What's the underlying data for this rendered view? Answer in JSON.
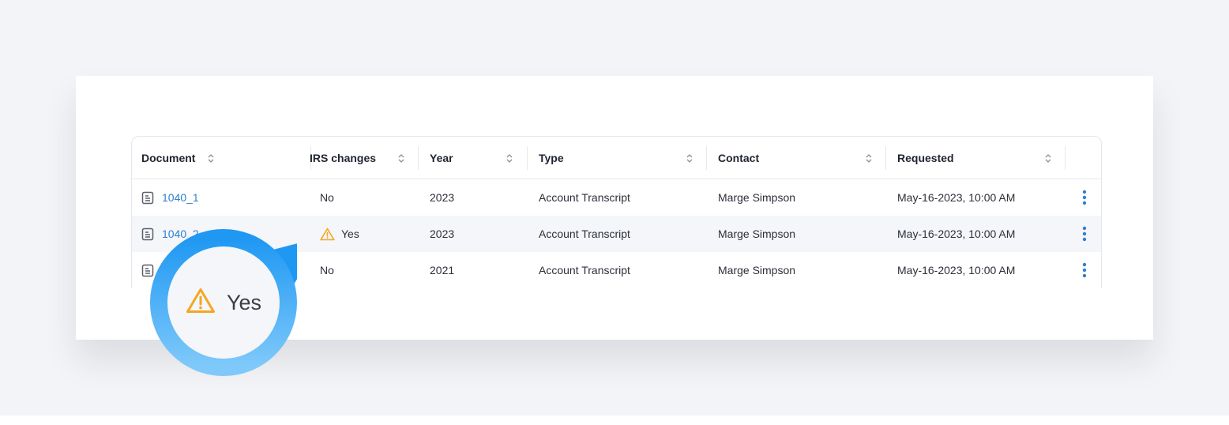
{
  "table": {
    "columns": [
      {
        "key": "document",
        "label": "Document"
      },
      {
        "key": "irs_changes",
        "label": "IRS changes"
      },
      {
        "key": "year",
        "label": "Year"
      },
      {
        "key": "type",
        "label": "Type"
      },
      {
        "key": "contact",
        "label": "Contact"
      },
      {
        "key": "requested",
        "label": "Requested"
      }
    ],
    "rows": [
      {
        "document": "1040_1",
        "irs_changes": "No",
        "irs_warning": false,
        "year": "2023",
        "type": "Account Transcript",
        "contact": "Marge Simpson",
        "requested": "May-16-2023, 10:00 AM"
      },
      {
        "document": "1040_2",
        "irs_changes": "Yes",
        "irs_warning": true,
        "year": "2023",
        "type": "Account Transcript",
        "contact": "Marge Simpson",
        "requested": "May-16-2023, 10:00 AM"
      },
      {
        "document": "",
        "irs_changes": "No",
        "irs_warning": false,
        "year": "2021",
        "type": "Account Transcript",
        "contact": "Marge Simpson",
        "requested": "May-16-2023, 10:00 AM"
      }
    ]
  },
  "magnifier": {
    "label": "Yes",
    "icon": "warning-icon"
  },
  "colors": {
    "link": "#2f7fd3",
    "warning": "#f5a623",
    "accent": "#2fa0f5",
    "row_alt": "#f4f6f9"
  }
}
